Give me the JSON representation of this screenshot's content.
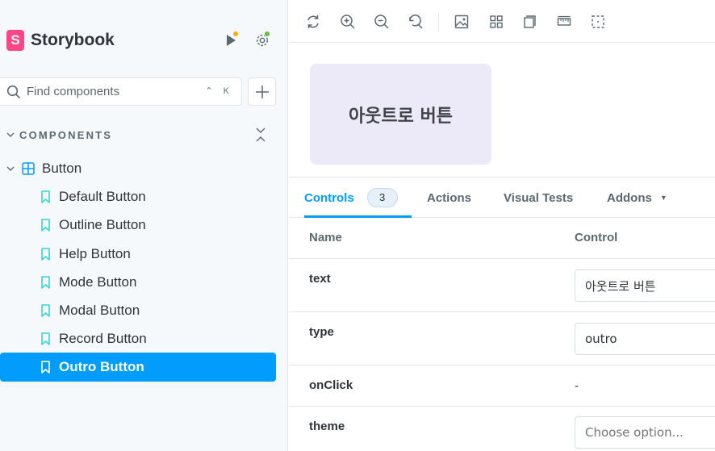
{
  "sidebar": {
    "brand": {
      "logo_letter": "S",
      "name": "Storybook"
    },
    "icons": {
      "run": "play-icon",
      "settings": "gear-icon",
      "add": "plus-icon",
      "search": "search-icon"
    },
    "status_colors": {
      "run_dot": "#ffae00",
      "settings_dot": "#66bf3c"
    },
    "search": {
      "placeholder": "Find components",
      "shortcut": "⌃ K"
    },
    "section_title": "COMPONENTS",
    "group": {
      "label": "Button",
      "icon": "component-icon"
    },
    "stories": [
      {
        "label": "Default Button"
      },
      {
        "label": "Outline Button"
      },
      {
        "label": "Help Button"
      },
      {
        "label": "Mode Button"
      },
      {
        "label": "Modal Button"
      },
      {
        "label": "Record Button"
      },
      {
        "label": "Outro Button"
      }
    ],
    "selected_index": 6
  },
  "toolbar": {
    "tools": [
      "reload-icon",
      "zoom-in-icon",
      "zoom-out-icon",
      "zoom-reset-icon",
      "background-icon",
      "grid-icon",
      "viewport-icon",
      "ruler-icon",
      "outline-icon"
    ]
  },
  "preview": {
    "button_text": "아웃트로 버튼",
    "button_color": "#ece9f8"
  },
  "panel": {
    "tabs": [
      {
        "label": "Controls",
        "badge": "3"
      },
      {
        "label": "Actions"
      },
      {
        "label": "Visual Tests"
      },
      {
        "label": "Addons"
      }
    ],
    "accent": "#029cfd"
  },
  "controls": {
    "headers": {
      "name": "Name",
      "control": "Control"
    },
    "rows": [
      {
        "name": "text",
        "value": "아웃트로 버튼"
      },
      {
        "name": "type",
        "value": "outro"
      },
      {
        "name": "onClick",
        "value": "-"
      },
      {
        "name": "theme",
        "placeholder": "Choose option..."
      }
    ]
  }
}
